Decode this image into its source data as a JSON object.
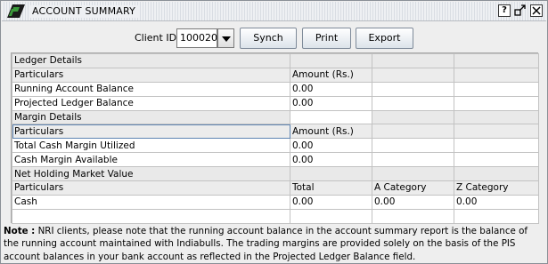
{
  "window": {
    "title": "ACCOUNT SUMMARY",
    "help_label": "?",
    "restore_label": "↗",
    "close_label": "✕"
  },
  "toolbar": {
    "client_label": "Client ID:",
    "client_value": "100020",
    "synch_label": "Synch",
    "print_label": "Print",
    "export_label": "Export"
  },
  "grid": {
    "ledger_title": "Ledger Details",
    "particulars": "Particulars",
    "amount_header": "Amount (Rs.)",
    "running_label": "Running Account Balance",
    "running_value": "0.00",
    "projected_label": "Projected Ledger Balance",
    "projected_value": "0.00",
    "margin_title": "Margin Details",
    "total_cash_label": "Total Cash Margin Utilized",
    "total_cash_value": "0.00",
    "cash_available_label": "Cash Margin Available",
    "cash_available_value": "0.00",
    "holding_title": "Net Holding Market Value",
    "total_header": "Total",
    "a_header": "A Category",
    "z_header": "Z Category",
    "cash_label": "Cash",
    "cash_total": "0.00",
    "cash_a": "0.00",
    "cash_z": "0.00"
  },
  "note": {
    "prefix": "Note :",
    "text": " NRI clients, please note that the running account balance in the account summary report is the balance of the running account maintained with Indiabulls. The trading margins are provided solely on the basis of the PIS account balances in your bank account as reflected in the Projected Ledger Balance field."
  },
  "colors": {
    "window_bg": "#eeeeee",
    "section_bg": "#e9e9e9",
    "logo_green": "#2e7d32"
  }
}
